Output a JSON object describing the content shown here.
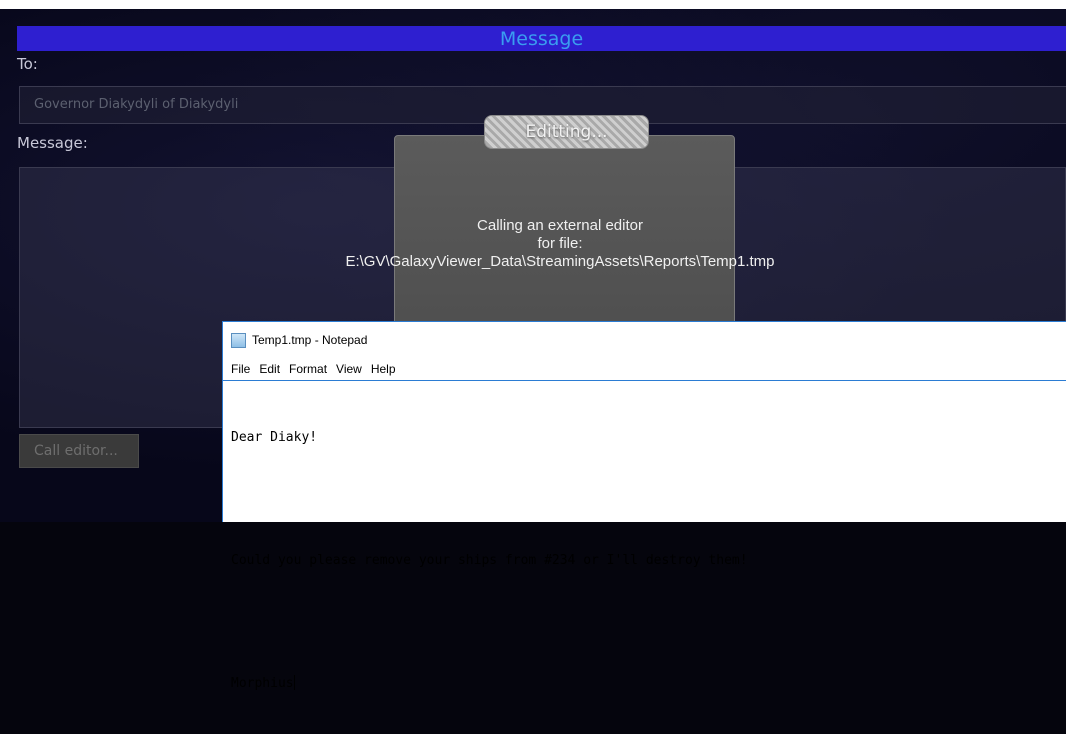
{
  "message_window": {
    "title": "Message",
    "to_label": "To:",
    "to_placeholder": "Governor Diakydyli of Diakydyli",
    "message_label": "Message:",
    "call_editor_label": "Call editor..."
  },
  "editing_dialog": {
    "title": "Editting...",
    "line1": "Calling an external editor",
    "line2": "for file:",
    "line3": "E:\\GV\\GalaxyViewer_Data\\StreamingAssets\\Reports\\Temp1.tmp"
  },
  "notepad": {
    "title": "Temp1.tmp - Notepad",
    "menu": [
      "File",
      "Edit",
      "Format",
      "View",
      "Help"
    ],
    "lines": [
      "Dear Diaky!",
      "Could you please remove your ships from #234 or I'll destroy them!",
      "Morphius"
    ]
  },
  "colors": {
    "title_bar": "#2e1fd0",
    "title_text": "#3a9df0",
    "notepad_border": "#2b7cd3"
  }
}
